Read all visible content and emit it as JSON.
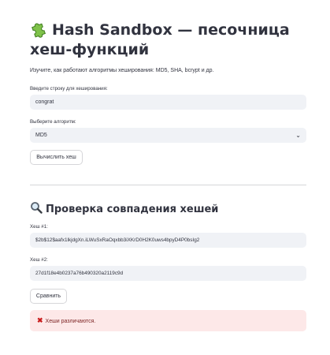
{
  "header": {
    "title_line1": "Hash Sandbox — песочница",
    "title_line2": "хеш-функций",
    "title_icon": "puzzle-piece-icon",
    "description": "Изучите, как работают алгоритмы хеширования: MD5, SHA, bcrypt и др."
  },
  "hashing": {
    "input_label": "Введите строку для хеширования:",
    "input_value": "congrat",
    "algo_label": "Выберите алгоритм:",
    "algo_value": "MD5",
    "compute_button": "Вычислить хеш"
  },
  "compare": {
    "section_icon": "magnifier-icon",
    "section_title": "Проверка совпадения хешей",
    "hash1_label": "Хеш #1:",
    "hash1_value": "$2b$12$aafx1lkjdgXn.iLWuSxRaOqxbb3iXKrD0H2K0uws4bpyD4P0bsIg2",
    "hash2_label": "Хеш #2:",
    "hash2_value": "27d1f18e4b0237a76b490320a2119c9d",
    "compare_button": "Сравнить",
    "result_icon": "cross-mark-icon",
    "result_text": "Хеши различаются.",
    "result_color": "#fde8e8"
  }
}
